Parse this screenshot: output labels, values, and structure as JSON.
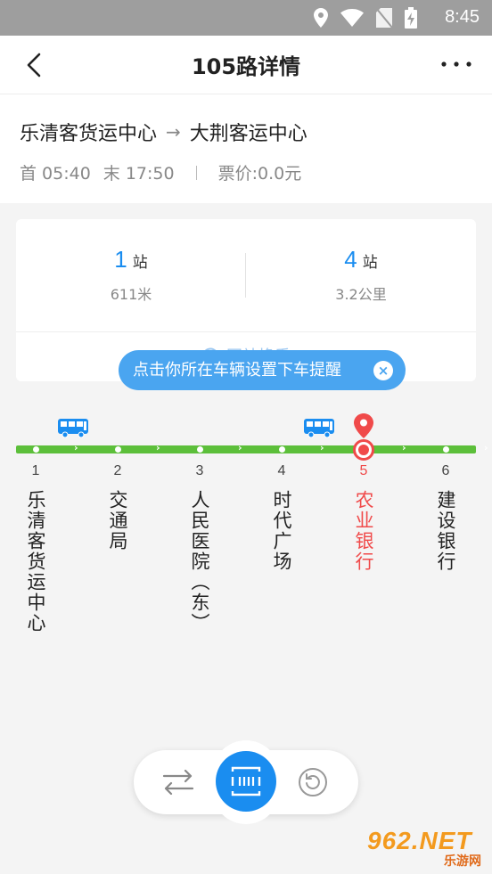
{
  "status_bar": {
    "time": "8:45",
    "icons": [
      "location-icon",
      "wifi-icon",
      "no-sim-icon",
      "battery-charging-icon"
    ]
  },
  "header": {
    "title": "105路详情",
    "back_icon": "chevron-left-icon",
    "more_icon": "more-icon"
  },
  "route": {
    "origin": "乐清客货运中心",
    "arrow": "→",
    "destination": "大荆客运中心",
    "first_bus": "首 05:40",
    "last_bus": "末 17:50",
    "fare": "票价:0.0元"
  },
  "stats": {
    "left": {
      "num": "1",
      "unit": "站",
      "sub": "611米"
    },
    "right": {
      "num": "4",
      "unit": "站",
      "sub": "3.2公里"
    },
    "transfer_label": "同站换乘"
  },
  "tooltip": {
    "text": "点击你所在车辆设置下车提醒",
    "close": "×"
  },
  "stations": [
    {
      "no": "1",
      "name": "乐清客货运中心"
    },
    {
      "no": "2",
      "name": "交通局"
    },
    {
      "no": "3",
      "name": "人民医院（东）"
    },
    {
      "no": "4",
      "name": "时代广场"
    },
    {
      "no": "5",
      "name": "农业银行"
    },
    {
      "no": "6",
      "name": "建设银行"
    }
  ],
  "current_station_index": 4,
  "bus_positions": [
    1,
    4
  ],
  "colors": {
    "accent": "#1a8df0",
    "line": "#5cbf3a",
    "current": "#f04a4a",
    "tooltip": "#4aa5f0"
  },
  "bottom_bar": {
    "left_icon": "switch-direction-icon",
    "center_icon": "bus-card-icon",
    "right_icon": "refresh-icon"
  },
  "watermark": {
    "top": "962.NET",
    "bottom": "乐游网"
  }
}
